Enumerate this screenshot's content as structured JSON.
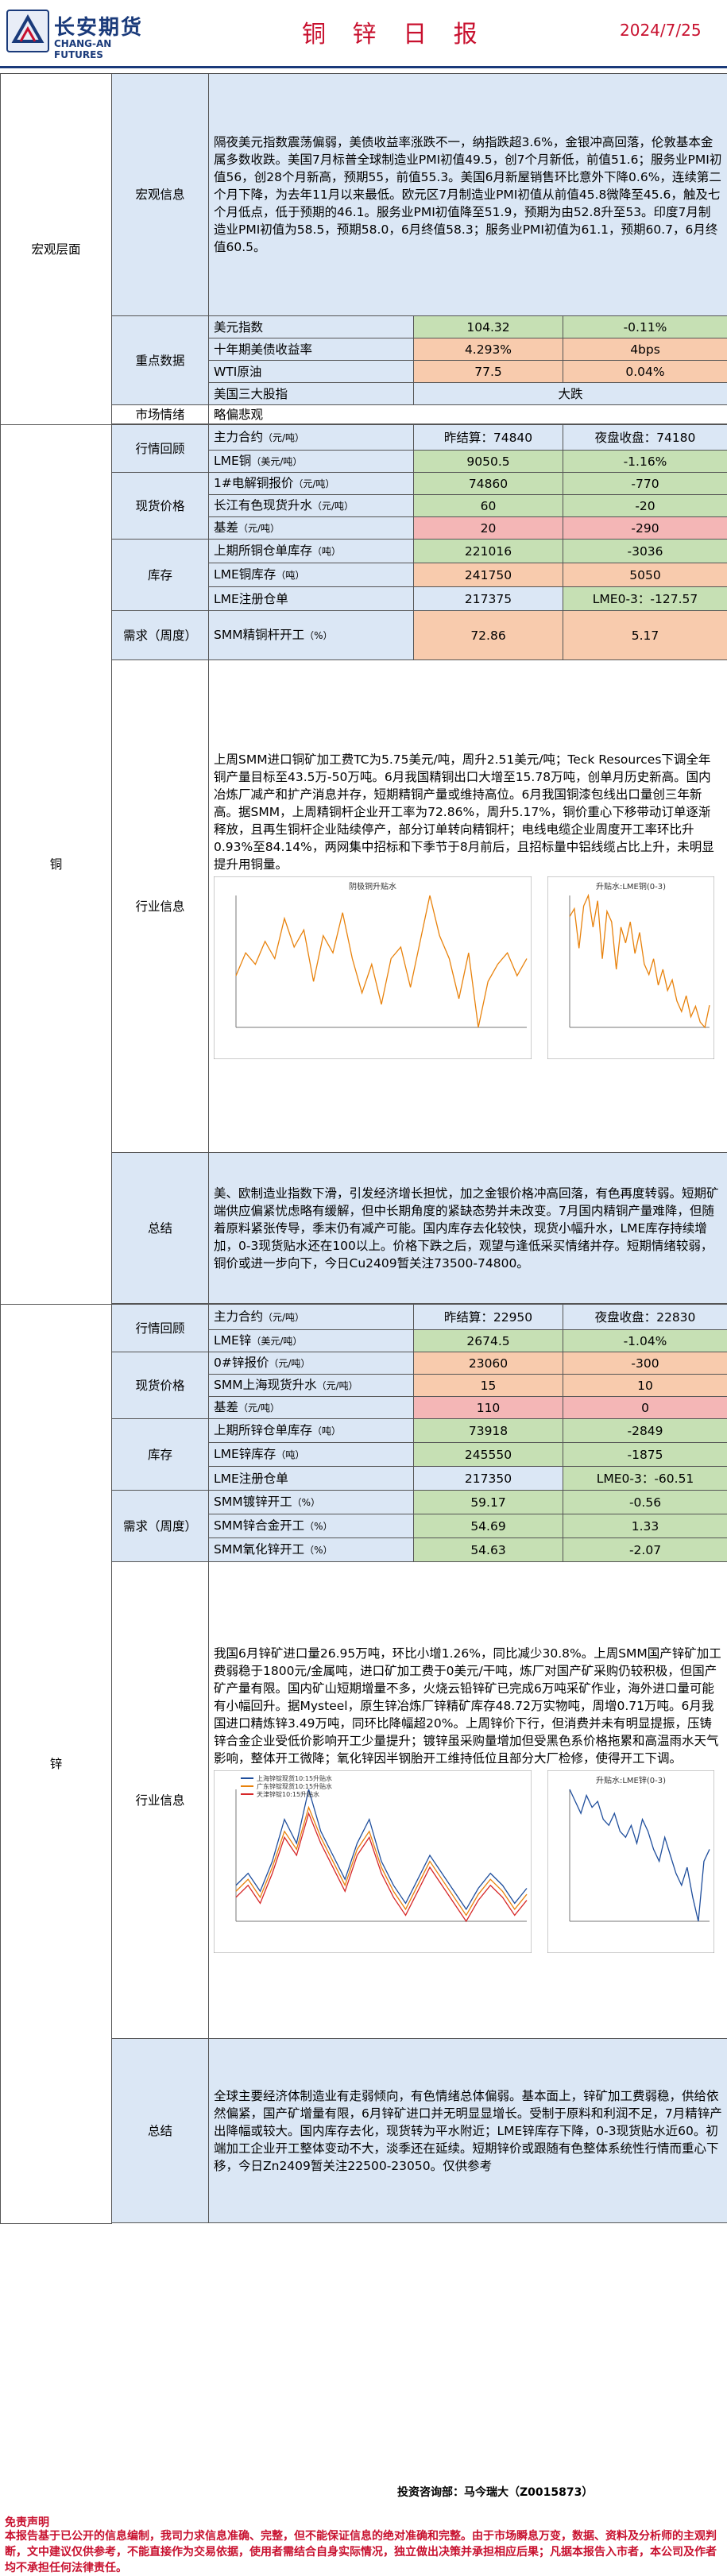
{
  "header": {
    "company": "长安期货",
    "company_en": "CHANG-AN FUTURES",
    "title": "铜 锌 日 报",
    "date": "2024/7/25"
  },
  "macro": {
    "section": "宏观层面",
    "info_label": "宏观信息",
    "info_text": "隔夜美元指数震荡偏弱，美债收益率涨跌不一，纳指跌超3.6%，金银冲高回落，伦敦基本金属多数收跌。美国7月标普全球制造业PMI初值49.5，创7个月新低，前值51.6；服务业PMI初值56，创28个月新高，预期55，前值55.3。美国6月新屋销售环比意外下降0.6%，连续第二个月下降，为去年11月以来最低。欧元区7月制造业PMI初值从前值45.8微降至45.6，触及七个月低点，低于预期的46.1。服务业PMI初值降至51.9，预期为由52.8升至53。印度7月制造业PMI初值为58.5，预期58.0，6月终值58.3；服务业PMI初值为61.1，预期60.7，6月终值60.5。",
    "key_label": "重点数据",
    "key_rows": [
      {
        "name": "美元指数",
        "v1": "104.32",
        "v2": "-0.11%"
      },
      {
        "name": "十年期美债收益率",
        "v1": "4.293%",
        "v2": "4bps"
      },
      {
        "name": "WTI原油",
        "v1": "77.5",
        "v2": "0.04%"
      },
      {
        "name": "美国三大股指",
        "v1": "大跌",
        "v2": ""
      }
    ],
    "sentiment_label": "市场情绪",
    "sentiment": "略偏悲观"
  },
  "copper": {
    "section": "铜",
    "review_label": "行情回顾",
    "main_label": "主力合约",
    "main_unit": "（元/吨）",
    "main_v1": "昨结算：74840",
    "main_v2": "夜盘收盘：74180",
    "lme_label": "LME铜",
    "lme_unit": "（美元/吨）",
    "lme_v1": "9050.5",
    "lme_v2": "-1.16%",
    "spot_label": "现货价格",
    "spot_rows": [
      {
        "name": "1#电解铜报价",
        "unit": "（元/吨）",
        "v1": "74860",
        "v2": "-770"
      },
      {
        "name": "长江有色现货升水",
        "unit": "（元/吨）",
        "v1": "60",
        "v2": "-20"
      },
      {
        "name": "基差",
        "unit": "（元/吨）",
        "v1": "20",
        "v2": "-290"
      }
    ],
    "inv_label": "库存",
    "inv_rows": [
      {
        "name": "上期所铜仓单库存",
        "unit": "（吨）",
        "v1": "221016",
        "v2": "-3036"
      },
      {
        "name": "LME铜库存",
        "unit": "（吨）",
        "v1": "241750",
        "v2": "5050"
      },
      {
        "name": "LME注册仓单",
        "unit": "",
        "v1": "217375",
        "v2": "LME0-3：-127.57"
      }
    ],
    "demand_label": "需求（周度）",
    "demand_name": "SMM精铜杆开工",
    "demand_unit": "（%）",
    "demand_v1": "72.86",
    "demand_v2": "5.17",
    "industry_label": "行业信息",
    "industry_text": "上周SMM进口铜矿加工费TC为5.75美元/吨，周升2.51美元/吨；Teck Resources下调全年铜产量目标至43.5万-50万吨。6月我国精铜出口大增至15.78万吨，创单月历史新高。国内冶炼厂减产和扩产消息并存，短期精铜产量或维持高位。6月我国铜漆包线出口量创三年新高。据SMM，上周精铜杆企业开工率为72.86%，周升5.17%，铜价重心下移带动订单逐渐释放，且再生铜杆企业陆续停产，部分订单转向精铜杆；电线电缆企业周度开工率环比升0.93%至84.14%，两网集中招标和下季节于8月前后，且招标量中铝线缆占比上升，未明显提升用铜量。",
    "chart1_title": "阴极铜升贴水",
    "chart2_title": "升贴水:LME铜(0-3)",
    "chart1_data": {
      "type": "line",
      "title": "阴极铜升贴水",
      "series": [
        {
          "values": [
            -20,
            60,
            20,
            100,
            40,
            180,
            80,
            140,
            -40,
            120,
            60,
            200,
            40,
            -80,
            20,
            -120,
            40,
            80,
            -60,
            100,
            260,
            120,
            40,
            -100,
            60,
            -200,
            -40,
            20,
            60,
            -20,
            40
          ]
        }
      ]
    },
    "chart2_data": {
      "type": "line",
      "title": "升贴水:LME铜(0-3)",
      "series": [
        {
          "values": [
            40,
            55,
            -20,
            60,
            80,
            20,
            70,
            -40,
            50,
            30,
            -60,
            20,
            -10,
            30,
            -30,
            10,
            -50,
            -70,
            -40,
            -90,
            -60,
            -100,
            -80,
            -120,
            -140,
            -110,
            -150,
            -130,
            -160,
            -170,
            -128
          ]
        }
      ]
    },
    "summary_label": "总结",
    "summary_text": "美、欧制造业指数下滑，引发经济增长担忧，加之金银价格冲高回落，有色再度转弱。短期矿端供应偏紧忧虑略有缓解，但中长期角度的紧缺态势并未改变。7月国内精铜产量难降，但随着原料紧张传导，季末仍有减产可能。国内库存去化较快，现货小幅升水，LME库存持续增加，0-3现货贴水还在100以上。价格下跌之后，观望与逢低采买情绪并存。短期情绪较弱，铜价或进一步向下，今日Cu2409暂关注73500-74800。"
  },
  "zinc": {
    "section": "锌",
    "review_label": "行情回顾",
    "main_label": "主力合约",
    "main_unit": "（元/吨）",
    "main_v1": "昨结算：22950",
    "main_v2": "夜盘收盘：22830",
    "lme_label": "LME锌",
    "lme_unit": "（美元/吨）",
    "lme_v1": "2674.5",
    "lme_v2": "-1.04%",
    "spot_label": "现货价格",
    "spot_rows": [
      {
        "name": "0#锌报价",
        "unit": "（元/吨）",
        "v1": "23060",
        "v2": "-300"
      },
      {
        "name": "SMM上海现货升水",
        "unit": "（元/吨）",
        "v1": "15",
        "v2": "10"
      },
      {
        "name": "基差",
        "unit": "（元/吨）",
        "v1": "110",
        "v2": "0"
      }
    ],
    "inv_label": "库存",
    "inv_rows": [
      {
        "name": "上期所锌仓单库存",
        "unit": "（吨）",
        "v1": "73918",
        "v2": "-2849"
      },
      {
        "name": "LME锌库存",
        "unit": "（吨）",
        "v1": "245550",
        "v2": "-1875"
      },
      {
        "name": "LME注册仓单",
        "unit": "",
        "v1": "217350",
        "v2": "LME0-3：-60.51"
      }
    ],
    "demand_label": "需求（周度）",
    "demand_rows": [
      {
        "name": "SMM镀锌开工",
        "unit": "（%）",
        "v1": "59.17",
        "v2": "-0.56"
      },
      {
        "name": "SMM锌合金开工",
        "unit": "（%）",
        "v1": "54.69",
        "v2": "1.33"
      },
      {
        "name": "SMM氧化锌开工",
        "unit": "（%）",
        "v1": "54.63",
        "v2": "-2.07"
      }
    ],
    "industry_label": "行业信息",
    "industry_text": "我国6月锌矿进口量26.95万吨，环比小增1.26%，同比减少30.8%。上周SMM国产锌矿加工费弱稳于1800元/金属吨，进口矿加工费于0美元/干吨，炼厂对国产矿采购仍较积极，但国产矿产量有限。国内矿山短期增量不多，火烧云铅锌矿已完成6万吨采矿作业，海外进口量可能有小幅回升。据Mysteel，原生锌冶炼厂锌精矿库存48.72万实物吨，周增0.71万吨。6月我国进口精炼锌3.49万吨，同环比降幅超20%。上周锌价下行，但消费并未有明显提振，压铸锌合金企业受低价影响开工少量提升；镀锌虽采购量增加但受黑色系价格拖累和高温雨水天气影响，整体开工微降；氧化锌因半钢胎开工维持低位且部分大厂检修，使得开工下调。",
    "chart1_legend": [
      "上海锌锭现货10:15升贴水",
      "广东锌锭现货10:15升贴水",
      "天津锌锭10:15升贴水"
    ],
    "chart2_title": "升贴水:LME锌(0-3)",
    "chart1_data": {
      "type": "line",
      "series": [
        {
          "name": "上海锌锭现货10:15升贴水",
          "values": [
            40,
            80,
            20,
            120,
            260,
            180,
            360,
            220,
            140,
            60,
            180,
            260,
            120,
            40,
            -20,
            60,
            140,
            80,
            20,
            -40,
            30,
            80,
            40,
            -20,
            30
          ]
        },
        {
          "name": "广东锌锭现货10:15升贴水",
          "values": [
            20,
            60,
            0,
            100,
            220,
            160,
            300,
            200,
            120,
            40,
            160,
            220,
            100,
            20,
            -40,
            40,
            120,
            60,
            0,
            -60,
            10,
            60,
            20,
            -40,
            10
          ]
        },
        {
          "name": "天津锌锭10:15升贴水",
          "values": [
            0,
            40,
            -20,
            80,
            200,
            140,
            280,
            180,
            100,
            20,
            140,
            200,
            80,
            0,
            -60,
            20,
            100,
            40,
            -20,
            -80,
            -10,
            40,
            0,
            -60,
            -10
          ]
        }
      ]
    },
    "chart2_data": {
      "type": "line",
      "title": "升贴水:LME锌(0-3)",
      "series": [
        {
          "values": [
            -10,
            -20,
            -30,
            -15,
            -25,
            -20,
            -35,
            -40,
            -30,
            -45,
            -50,
            -40,
            -55,
            -35,
            -45,
            -60,
            -70,
            -50,
            -65,
            -80,
            -90,
            -75,
            -100,
            -120,
            -70,
            -60
          ]
        }
      ]
    },
    "summary_label": "总结",
    "summary_text": "全球主要经济体制造业有走弱倾向，有色情绪总体偏弱。基本面上，锌矿加工费弱稳，供给依然偏紧，国产矿增量有限，6月锌矿进口并无明显显增长。受制于原料和利润不足，7月精锌产出降幅或较大。国内库存去化，现货转为平水附近；LME锌库存下降，0-3现货贴水近60。初端加工企业开工整体变动不大，淡季还在延续。短期锌价或跟随有色整体系统性行情而重心下移，今日Zn2409暂关注22500-23050。仅供参考"
  },
  "footer": {
    "analyst": "投资咨询部：马今瑞大（Z0015873）",
    "disclaimer_title": "免责声明",
    "disclaimer": "本报告基于已公开的信息编制，我司力求信息准确、完整，但不能保证信息的绝对准确和完整。由于市场瞬息万变，数据、资料及分析师的主观判断，文中建议仅供参考，不能直接作为交易依据，使用者需结合自身实际情况，独立做出决策并承担相应后果；凡据本报告入市者，本公司及作者均不承担任何法律责任。"
  },
  "colors": {
    "brand": "#1a3a7a",
    "title": "#c8102e",
    "blue": "#dbe7f5",
    "green": "#c6e0b4",
    "orange": "#f8cbad",
    "pink": "#f4b6b6",
    "line": "#e8820c"
  }
}
